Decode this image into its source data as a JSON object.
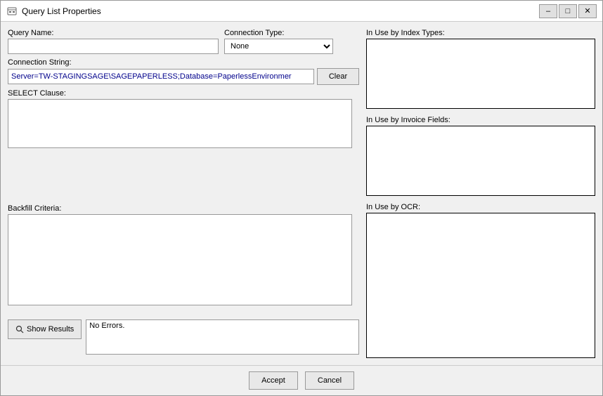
{
  "window": {
    "title": "Query List Properties",
    "icon": "list-icon"
  },
  "title_bar_controls": {
    "minimize": "–",
    "maximize": "□",
    "close": "✕"
  },
  "form": {
    "query_name_label": "Query Name:",
    "query_name_value": "",
    "query_name_placeholder": "",
    "connection_type_label": "Connection Type:",
    "connection_type_value": "None",
    "connection_type_options": [
      "None"
    ],
    "connection_string_label": "Connection String:",
    "connection_string_value": "Server=TW-STAGINGSAGE\\SAGEPAPERLESS;Database=PaperlessEnvironmer",
    "clear_button": "Clear",
    "select_clause_label": "SELECT Clause:",
    "select_clause_value": "",
    "backfill_criteria_label": "Backfill Criteria:",
    "backfill_criteria_value": "",
    "show_results_button": "Show Results",
    "errors_value": "No Errors."
  },
  "right_panel": {
    "index_types_label": "In Use by Index Types:",
    "index_types_value": "",
    "invoice_fields_label": "In Use by Invoice Fields:",
    "invoice_fields_value": "",
    "ocr_label": "In Use by OCR:",
    "ocr_value": ""
  },
  "footer": {
    "accept_label": "Accept",
    "cancel_label": "Cancel"
  }
}
